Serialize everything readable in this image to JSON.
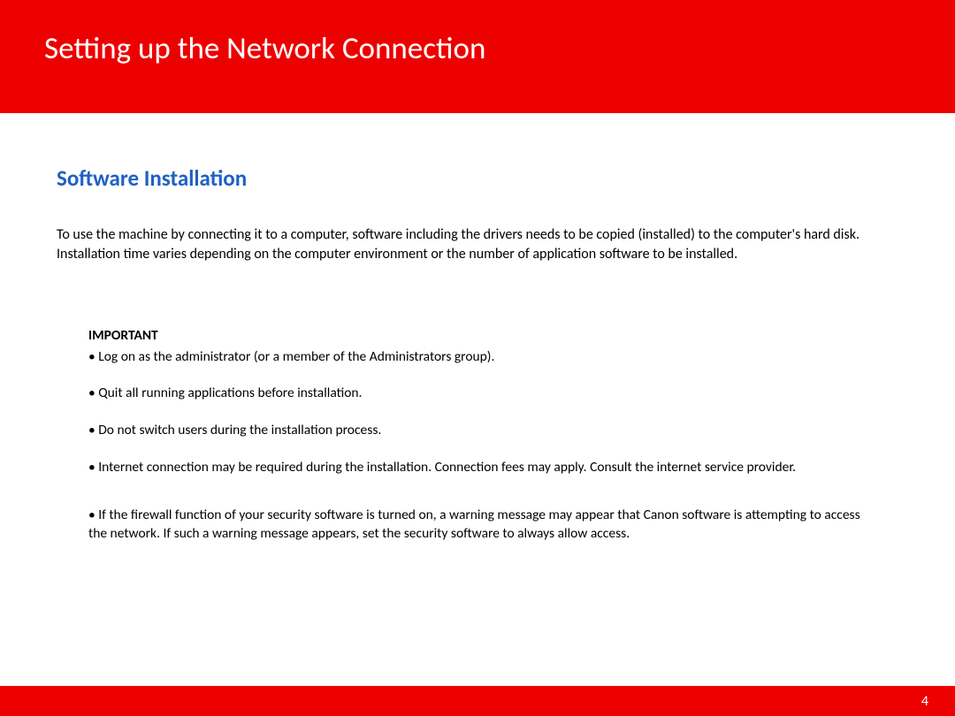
{
  "header": {
    "title": "Setting up the Network Connection"
  },
  "section": {
    "heading": "Software Installation",
    "intro": "To use the machine by connecting it to a computer, software including the drivers needs to be copied (installed) to the computer's hard disk. Installation time varies depending on the computer environment or the number of application software to be installed."
  },
  "important": {
    "label": "IMPORTANT",
    "bullets": [
      "• Log on as the administrator (or a member of the Administrators group).",
      "• Quit all running applications before installation.",
      "• Do not switch users during the installation process.",
      "• Internet connection may be required during the installation. Connection fees may apply. Consult the internet service provider.",
      "• If the firewall function of your security software is turned on, a warning message may appear that Canon software is attempting to access the network. If such a warning message appears, set the security software to always allow access."
    ]
  },
  "footer": {
    "page_number": "4"
  }
}
